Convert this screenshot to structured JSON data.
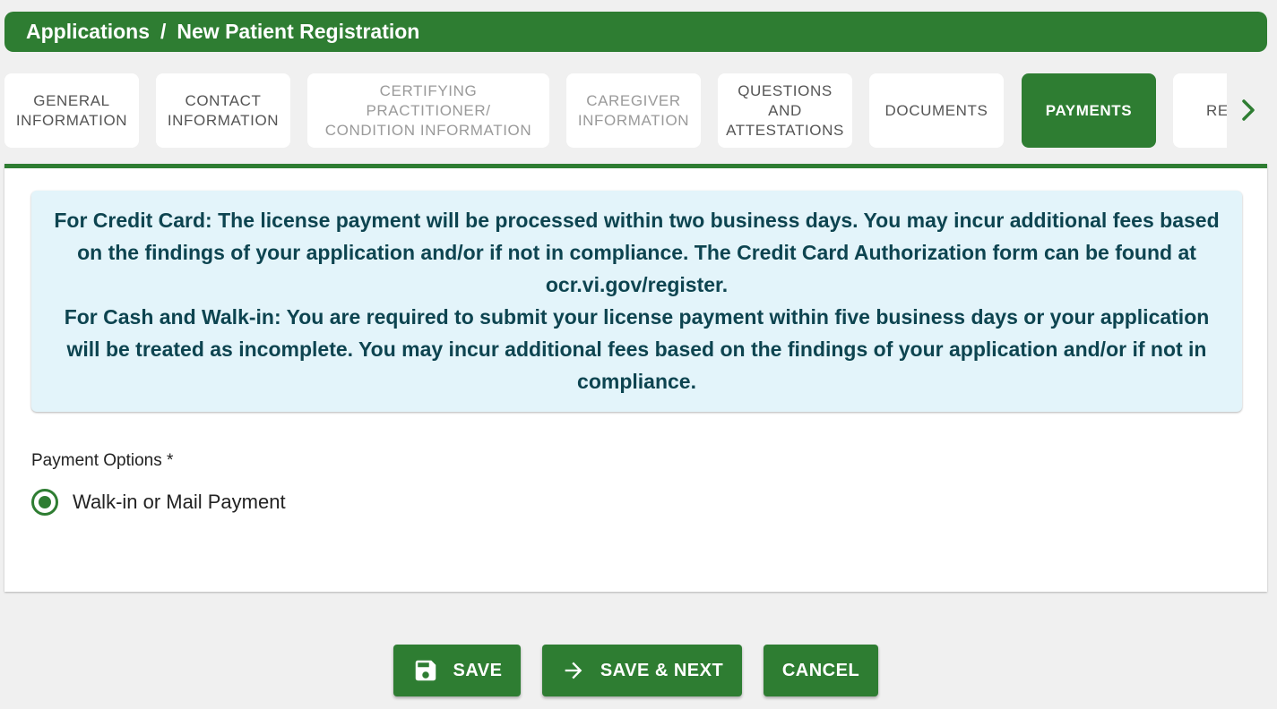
{
  "breadcrumb": {
    "root": "Applications",
    "separator": "/",
    "current": "New Patient Registration"
  },
  "tabs": [
    {
      "line1": "GENERAL",
      "line2": "INFORMATION",
      "line3": ""
    },
    {
      "line1": "CONTACT",
      "line2": "INFORMATION",
      "line3": ""
    },
    {
      "line1": "CERTIFYING",
      "line2": "PRACTITIONER/",
      "line3": "CONDITION INFORMATION"
    },
    {
      "line1": "CAREGIVER",
      "line2": "INFORMATION",
      "line3": ""
    },
    {
      "line1": "QUESTIONS",
      "line2": "AND",
      "line3": "ATTESTATIONS"
    },
    {
      "line1": "DOCUMENTS",
      "line2": "",
      "line3": ""
    },
    {
      "line1": "PAYMENTS",
      "line2": "",
      "line3": ""
    },
    {
      "line1": "RE",
      "line2": "",
      "line3": ""
    }
  ],
  "notice": {
    "credit_card": "For Credit Card: The license payment will be processed within two business days. You may incur additional fees based on the findings of your application and/or if not in compliance. The Credit Card Authorization form can be found at ocr.vi.gov/register.",
    "cash": "For Cash and Walk-in: You are required to submit your license payment within five business days or your application will be treated as incomplete. You may incur additional fees based on the findings of your application and/or if not in compliance."
  },
  "payment": {
    "label": "Payment Options *",
    "options": [
      {
        "label": "Walk-in or Mail Payment",
        "selected": true
      }
    ]
  },
  "buttons": {
    "save": "SAVE",
    "save_next": "SAVE & NEXT",
    "cancel": "CANCEL"
  },
  "icons": {
    "save": "floppy-disk-icon",
    "save_next": "arrow-right-icon",
    "tab_scroll": "chevron-right-icon"
  },
  "colors": {
    "primary": "#2e7d32",
    "notice_bg": "#e3f4fa",
    "notice_text": "#0d4450",
    "page_bg": "#f0f0f0"
  }
}
